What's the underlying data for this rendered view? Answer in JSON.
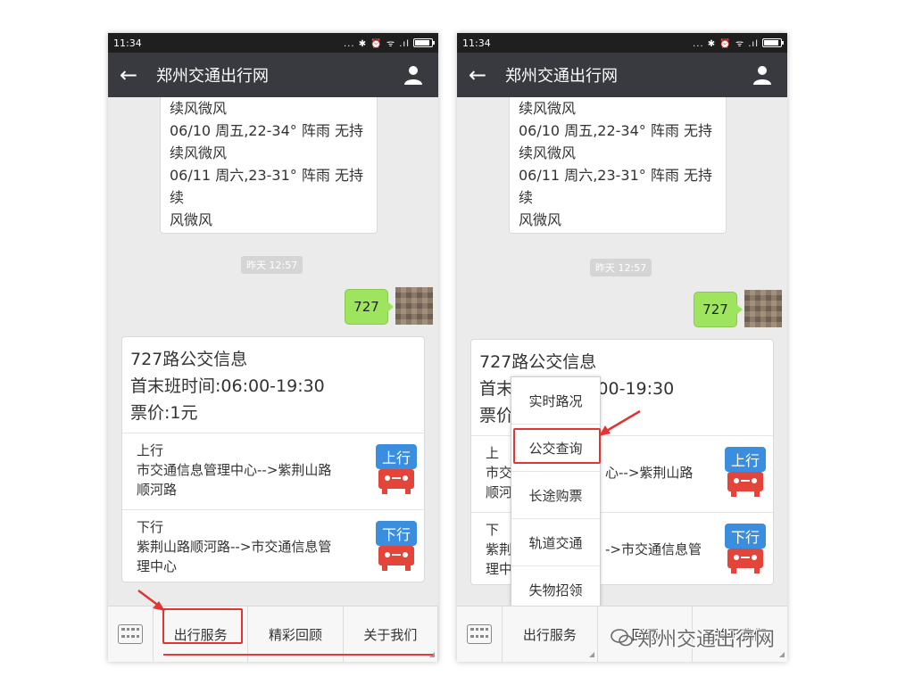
{
  "status": {
    "time": "11:34",
    "indicators": "... ✱ ⏰ ᯤ .ıl"
  },
  "header": {
    "back_icon": "back-arrow-icon",
    "title": "郑州交通出行网",
    "profile_icon": "person-icon"
  },
  "weather": {
    "lines": [
      "续风微风",
      "06/10 周五,22-34° 阵雨 无持",
      "续风微风",
      "06/11 周六,23-31° 阵雨 无持续",
      "风微风"
    ]
  },
  "timestamp": "昨天 12:57",
  "user_message": "727",
  "bus": {
    "title": "727路公交信息",
    "hours": "首末班时间:06:00-19:30",
    "fare": "票价:1元",
    "up": {
      "label": "上行",
      "line1": "市交通信息管理中心-->紫荆山路",
      "line2": "顺河路",
      "icon_text": "上行"
    },
    "down": {
      "label": "下行",
      "line1": "紫荆山路顺河路-->市交通信息管",
      "line2": "理中心",
      "icon_text": "下行"
    }
  },
  "menu": {
    "tab1": "出行服务",
    "tab2": "精彩回顾",
    "tab3": "关于我们"
  },
  "popup": [
    "实时路况",
    "公交查询",
    "长途购票",
    "轨道交通",
    "失物招领"
  ],
  "right_partial": {
    "bus_title": "727路公交信息",
    "hours_tail": ":00-19:30",
    "hours_head": "首末",
    "fare_head": "票价",
    "up_label": "上",
    "up_line1_head": "市交",
    "up_line1_tail": "心-->紫荆山路",
    "up_line2_head": "顺河",
    "down_label": "下",
    "down_line1_head": "紫荆",
    "down_line1_tail": "->市交通信息管",
    "down_line2_head": "理中",
    "tab2_partial": "回顾",
    "tab3_partial": "关于我们"
  },
  "watermark": "郑州交通出行网",
  "colors": {
    "titlebar": "#393a3f",
    "bubble": "#9ee45f",
    "highlight": "#e03535",
    "bus_icon_blue": "#3b8ede",
    "bus_icon_red": "#e4453b"
  }
}
